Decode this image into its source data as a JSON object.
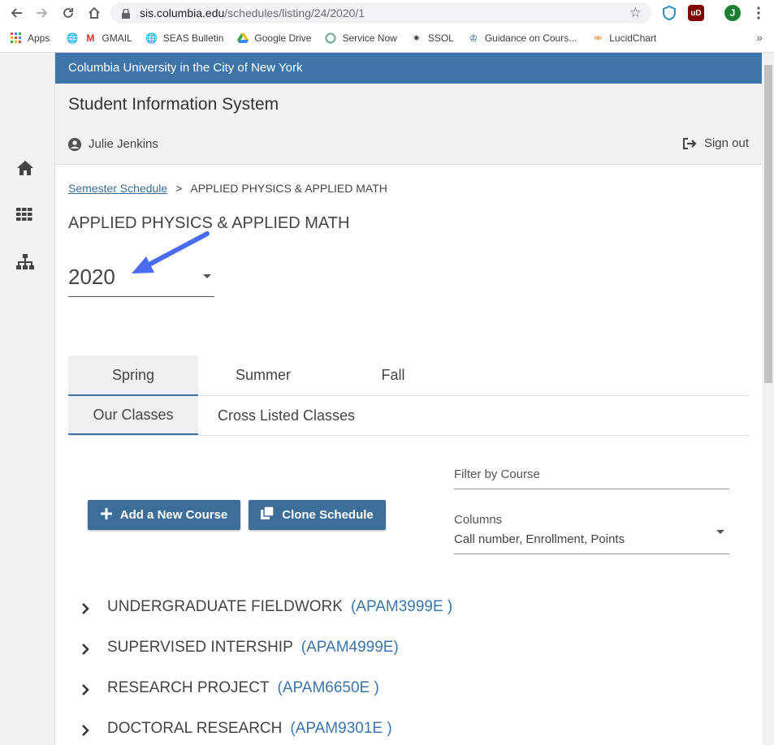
{
  "browser": {
    "url_host": "sis.columbia.edu",
    "url_path": "/schedules/listing/24/2020/1",
    "profile_initial": "J",
    "bookmarks": [
      "Apps",
      "GMAIL",
      "SEAS Bulletin",
      "Google Drive",
      "Service Now",
      "SSOL",
      "Guidance on Cours...",
      "LucidChart"
    ],
    "more": "»"
  },
  "header": {
    "university": "Columbia University in the City of New York",
    "system_title": "Student Information System",
    "user_name": "Julie Jenkins",
    "sign_out": "Sign out",
    "accent": "#3d75a8"
  },
  "breadcrumb": {
    "link": "Semester Schedule",
    "separator": ">",
    "current": "APPLIED PHYSICS & APPLIED MATH"
  },
  "department_title": "APPLIED PHYSICS & APPLIED MATH",
  "year_select": {
    "value": "2020"
  },
  "semester_tabs": [
    {
      "label": "Spring",
      "active": true
    },
    {
      "label": "Summer",
      "active": false
    },
    {
      "label": "Fall",
      "active": false
    }
  ],
  "class_tabs": [
    {
      "label": "Our Classes",
      "active": true
    },
    {
      "label": "Cross Listed Classes",
      "active": false
    }
  ],
  "buttons": {
    "add_course": "Add a New Course",
    "clone_schedule": "Clone Schedule"
  },
  "filter": {
    "placeholder": "Filter by Course"
  },
  "columns": {
    "label": "Columns",
    "value": "Call number, Enrollment, Points"
  },
  "courses": [
    {
      "name": "UNDERGRADUATE FIELDWORK",
      "code": "(APAM3999E )"
    },
    {
      "name": "SUPERVISED INTERSHIP",
      "code": "(APAM4999E)"
    },
    {
      "name": "RESEARCH PROJECT",
      "code": "(APAM6650E )"
    },
    {
      "name": "DOCTORAL RESEARCH",
      "code": "(APAM9301E )"
    }
  ]
}
